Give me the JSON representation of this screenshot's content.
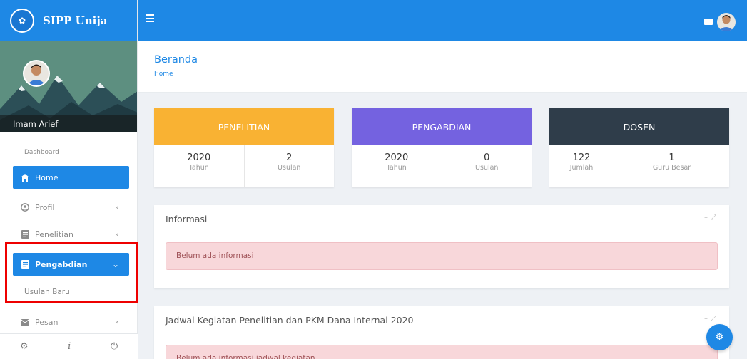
{
  "brand": {
    "title": "SIPP Unija"
  },
  "user": {
    "name": "Imam Arief"
  },
  "sidebar": {
    "heading": "Dashboard",
    "items": [
      {
        "label": "Home",
        "icon": "home-icon"
      },
      {
        "label": "Profil",
        "icon": "user-circle-icon"
      },
      {
        "label": "Penelitian",
        "icon": "document-icon"
      },
      {
        "label": "Pengabdian",
        "icon": "document-icon"
      },
      {
        "label": "Pesan",
        "icon": "mail-icon"
      }
    ],
    "subitem": "Usulan Baru",
    "footer": {
      "settings": "⚙",
      "info": "i",
      "power": "⏻"
    }
  },
  "header": {
    "title": "Beranda",
    "breadcrumb": "Home"
  },
  "cards": [
    {
      "title": "PENELITIAN",
      "color": "#f9b233",
      "stats": [
        {
          "value": "2020",
          "label": "Tahun"
        },
        {
          "value": "2",
          "label": "Usulan"
        }
      ]
    },
    {
      "title": "PENGABDIAN",
      "color": "#7462e0",
      "stats": [
        {
          "value": "2020",
          "label": "Tahun"
        },
        {
          "value": "0",
          "label": "Usulan"
        }
      ]
    },
    {
      "title": "DOSEN",
      "color": "#2f3d4a",
      "stats": [
        {
          "value": "122",
          "label": "Jumlah"
        },
        {
          "value": "1",
          "label": "Guru Besar"
        }
      ]
    }
  ],
  "panels": [
    {
      "title": "Informasi",
      "message": "Belum ada informasi"
    },
    {
      "title": "Jadwal Kegiatan Penelitian dan PKM Dana Internal 2020",
      "message": "Belum ada informasi jadwal kegiatan"
    }
  ],
  "colors": {
    "primary": "#1e88e5",
    "highlight": "#ee0000",
    "alert_bg": "#f8d7da"
  }
}
